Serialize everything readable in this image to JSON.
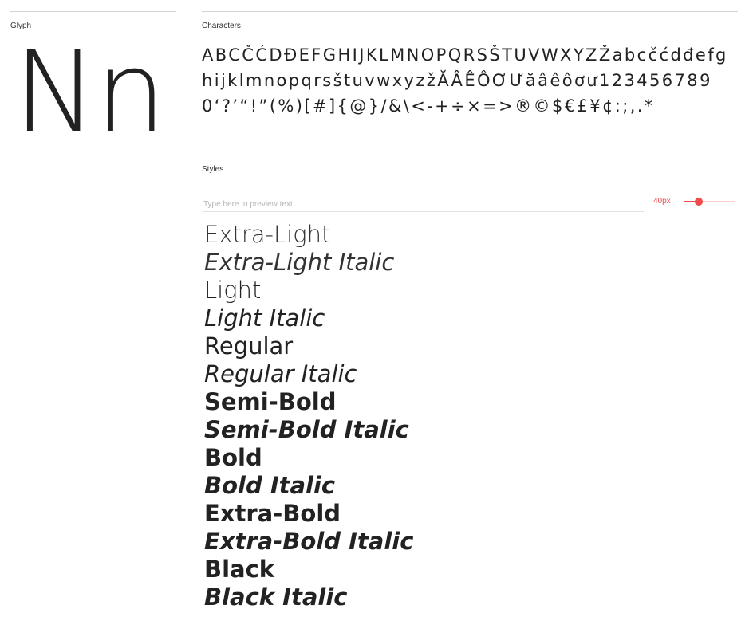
{
  "glyph": {
    "label": "Glyph",
    "sample": "Nn"
  },
  "characters": {
    "label": "Characters",
    "text": "ABCČĆDĐEFGHIJKLMNOPQRSŠTUVWXYZŽabcčćdđefghijklmnopqrsštuvwxyzžĂÂÊÔƠƯăâêôơư1234567890‘?’“!”(%)[#]{@}/&\\<-+÷×=>®©$€£¥¢:;,.*"
  },
  "styles": {
    "label": "Styles",
    "preview_placeholder": "Type here to preview text",
    "preview_value": "",
    "size_label": "40px",
    "size_slider_fraction": 0.3,
    "accent_color": "#f04a4a",
    "items": [
      "Extra-Light",
      "Extra-Light Italic",
      "Light",
      "Light Italic",
      "Regular",
      "Regular Italic",
      "Semi-Bold",
      "Semi-Bold Italic",
      "Bold",
      "Bold Italic",
      "Extra-Bold",
      "Extra-Bold Italic",
      "Black",
      "Black Italic"
    ]
  }
}
